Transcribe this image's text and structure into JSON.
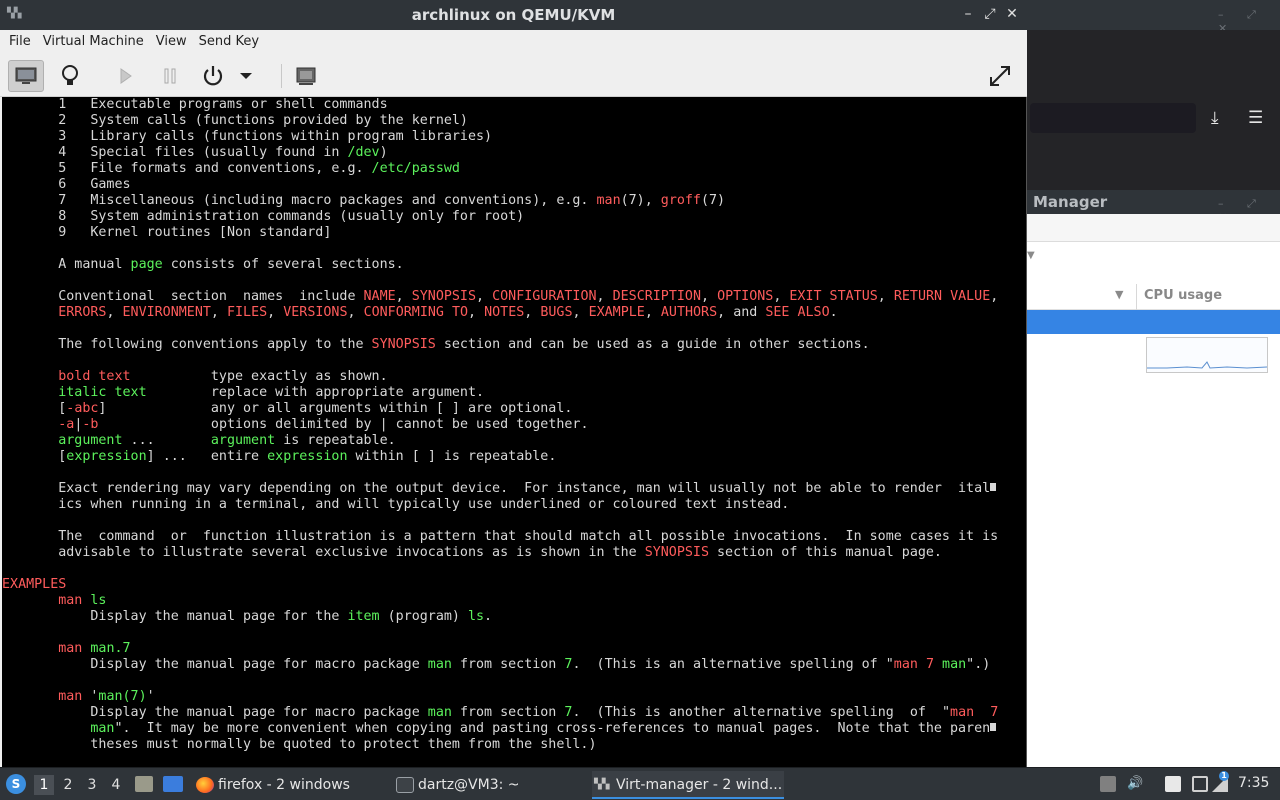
{
  "background": {
    "virt_manager_title": "Manager",
    "virt_manager_column": "CPU usage"
  },
  "window": {
    "title": "archlinux on QEMU/KVM",
    "controls": [
      "–",
      "⤢",
      "✕"
    ]
  },
  "menubar": [
    "File",
    "Virtual Machine",
    "View",
    "Send Key"
  ],
  "toolbar": {
    "buttons": [
      "console-icon",
      "details-lightbulb-icon",
      "run-icon",
      "pause-icon",
      "power-icon",
      "dropdown-arrow-icon",
      "snapshot-icon",
      "fullscreen-icon"
    ]
  },
  "console": {
    "colors": {
      "normal": "#d8d8d8",
      "red": "#ff5c5c",
      "green": "#5cf25c"
    },
    "lines": [
      {
        "y": 0,
        "s": [
          [
            "w",
            "       1   Executable programs or shell commands"
          ]
        ]
      },
      {
        "y": 1,
        "s": [
          [
            "w",
            "       2   System calls (functions provided by the kernel)"
          ]
        ]
      },
      {
        "y": 2,
        "s": [
          [
            "w",
            "       3   Library calls (functions within program libraries)"
          ]
        ]
      },
      {
        "y": 3,
        "s": [
          [
            "w",
            "       4   Special files (usually found in "
          ],
          [
            "g",
            "/dev"
          ],
          [
            "w",
            ")"
          ]
        ]
      },
      {
        "y": 4,
        "s": [
          [
            "w",
            "       5   File formats and conventions, e.g. "
          ],
          [
            "g",
            "/etc/passwd"
          ]
        ]
      },
      {
        "y": 5,
        "s": [
          [
            "w",
            "       6   Games"
          ]
        ]
      },
      {
        "y": 6,
        "s": [
          [
            "w",
            "       7   Miscellaneous (including macro packages and conventions), e.g. "
          ],
          [
            "r",
            "man"
          ],
          [
            "w",
            "(7), "
          ],
          [
            "r",
            "groff"
          ],
          [
            "w",
            "(7)"
          ]
        ]
      },
      {
        "y": 7,
        "s": [
          [
            "w",
            "       8   System administration commands (usually only for root)"
          ]
        ]
      },
      {
        "y": 8,
        "s": [
          [
            "w",
            "       9   Kernel routines [Non standard]"
          ]
        ]
      },
      {
        "y": 10,
        "s": [
          [
            "w",
            "       A manual "
          ],
          [
            "g",
            "page"
          ],
          [
            "w",
            " consists of several sections."
          ]
        ]
      },
      {
        "y": 12,
        "s": [
          [
            "w",
            "       Conventional  section  names  include "
          ],
          [
            "r",
            "NAME"
          ],
          [
            "w",
            ", "
          ],
          [
            "r",
            "SYNOPSIS"
          ],
          [
            "w",
            ", "
          ],
          [
            "r",
            "CONFIGURATION"
          ],
          [
            "w",
            ", "
          ],
          [
            "r",
            "DESCRIPTION"
          ],
          [
            "w",
            ", "
          ],
          [
            "r",
            "OPTIONS"
          ],
          [
            "w",
            ", "
          ],
          [
            "r",
            "EXIT STATUS"
          ],
          [
            "w",
            ", "
          ],
          [
            "r",
            "RETURN VALUE"
          ],
          [
            "w",
            ","
          ]
        ]
      },
      {
        "y": 13,
        "s": [
          [
            "r",
            "       ERRORS"
          ],
          [
            "w",
            ", "
          ],
          [
            "r",
            "ENVIRONMENT"
          ],
          [
            "w",
            ", "
          ],
          [
            "r",
            "FILES"
          ],
          [
            "w",
            ", "
          ],
          [
            "r",
            "VERSIONS"
          ],
          [
            "w",
            ", "
          ],
          [
            "r",
            "CONFORMING TO"
          ],
          [
            "w",
            ", "
          ],
          [
            "r",
            "NOTES"
          ],
          [
            "w",
            ", "
          ],
          [
            "r",
            "BUGS"
          ],
          [
            "w",
            ", "
          ],
          [
            "r",
            "EXAMPLE"
          ],
          [
            "w",
            ", "
          ],
          [
            "r",
            "AUTHORS"
          ],
          [
            "w",
            ", and "
          ],
          [
            "r",
            "SEE ALSO"
          ],
          [
            "w",
            "."
          ]
        ]
      },
      {
        "y": 15,
        "s": [
          [
            "w",
            "       The following conventions apply to the "
          ],
          [
            "r",
            "SYNOPSIS"
          ],
          [
            "w",
            " section and can be used as a guide in other sections."
          ]
        ]
      },
      {
        "y": 17,
        "s": [
          [
            "r",
            "       bold text"
          ],
          [
            "w",
            "          type exactly as shown."
          ]
        ]
      },
      {
        "y": 18,
        "s": [
          [
            "g",
            "       italic text"
          ],
          [
            "w",
            "        replace with appropriate argument."
          ]
        ]
      },
      {
        "y": 19,
        "s": [
          [
            "w",
            "       ["
          ],
          [
            "r",
            "-abc"
          ],
          [
            "w",
            "]             any or all arguments within [ ] are optional."
          ]
        ]
      },
      {
        "y": 20,
        "s": [
          [
            "r",
            "       -a"
          ],
          [
            "w",
            "|"
          ],
          [
            "r",
            "-b"
          ],
          [
            "w",
            "              options delimited by | cannot be used together."
          ]
        ]
      },
      {
        "y": 21,
        "s": [
          [
            "g",
            "       argument"
          ],
          [
            "w",
            " ...       "
          ],
          [
            "g",
            "argument"
          ],
          [
            "w",
            " is repeatable."
          ]
        ]
      },
      {
        "y": 22,
        "s": [
          [
            "w",
            "       ["
          ],
          [
            "g",
            "expression"
          ],
          [
            "w",
            "] ...   entire "
          ],
          [
            "g",
            "expression"
          ],
          [
            "w",
            " within [ ] is repeatable."
          ]
        ]
      },
      {
        "y": 24,
        "s": [
          [
            "w",
            "       Exact rendering may vary depending on the output device.  For instance, man will usually not be able to render  ital"
          ],
          [
            "cu",
            ""
          ]
        ]
      },
      {
        "y": 25,
        "s": [
          [
            "w",
            "       ics when running in a terminal, and will typically use underlined or coloured text instead."
          ]
        ]
      },
      {
        "y": 27,
        "s": [
          [
            "w",
            "       The  command  or  function illustration is a pattern that should match all possible invocations.  In some cases it is"
          ]
        ]
      },
      {
        "y": 28,
        "s": [
          [
            "w",
            "       advisable to illustrate several exclusive invocations as is shown in the "
          ],
          [
            "r",
            "SYNOPSIS"
          ],
          [
            "w",
            " section of this manual page."
          ]
        ]
      },
      {
        "y": 30,
        "s": [
          [
            "r",
            "EXAMPLES"
          ]
        ]
      },
      {
        "y": 31,
        "s": [
          [
            "r",
            "       man "
          ],
          [
            "g",
            "ls"
          ]
        ]
      },
      {
        "y": 32,
        "s": [
          [
            "w",
            "           Display the manual page for the "
          ],
          [
            "g",
            "item"
          ],
          [
            "w",
            " (program) "
          ],
          [
            "g",
            "ls"
          ],
          [
            "w",
            "."
          ]
        ]
      },
      {
        "y": 34,
        "s": [
          [
            "r",
            "       man "
          ],
          [
            "g",
            "man.7"
          ]
        ]
      },
      {
        "y": 35,
        "s": [
          [
            "w",
            "           Display the manual page for macro package "
          ],
          [
            "g",
            "man"
          ],
          [
            "w",
            " from section "
          ],
          [
            "g",
            "7"
          ],
          [
            "w",
            ".  (This is an alternative spelling of \""
          ],
          [
            "r",
            "man"
          ],
          [
            "w",
            " "
          ],
          [
            "r",
            "7"
          ],
          [
            "w",
            " "
          ],
          [
            "g",
            "man"
          ],
          [
            "w",
            "\".)"
          ]
        ]
      },
      {
        "y": 37,
        "s": [
          [
            "r",
            "       man "
          ],
          [
            "w",
            "'"
          ],
          [
            "g",
            "man(7)"
          ],
          [
            "w",
            "'"
          ]
        ]
      },
      {
        "y": 38,
        "s": [
          [
            "w",
            "           Display the manual page for macro package "
          ],
          [
            "g",
            "man"
          ],
          [
            "w",
            " from section "
          ],
          [
            "g",
            "7"
          ],
          [
            "w",
            ".  (This is another alternative spelling  of  \""
          ],
          [
            "r",
            "man"
          ],
          [
            "w",
            "  "
          ],
          [
            "r",
            "7"
          ]
        ]
      },
      {
        "y": 39,
        "s": [
          [
            "g",
            "           man"
          ],
          [
            "w",
            "\".  It may be more convenient when copying and pasting cross-references to manual pages.  Note that the paren"
          ],
          [
            "cu",
            ""
          ]
        ]
      },
      {
        "y": 40,
        "s": [
          [
            "w",
            "           theses must normally be quoted to protect them from the shell.)"
          ]
        ]
      }
    ]
  },
  "taskbar": {
    "workspaces": [
      "1",
      "2",
      "3",
      "4"
    ],
    "active_workspace": "1",
    "tasks": [
      {
        "label": "firefox - 2 windows",
        "icon": "firefox-icon"
      },
      {
        "label": "dartz@VM3: ~",
        "icon": "terminal-icon"
      },
      {
        "label": "Virt-manager - 2 wind...",
        "icon": "virt-manager-icon"
      }
    ],
    "tray_notification": "1",
    "clock": "7:35"
  }
}
